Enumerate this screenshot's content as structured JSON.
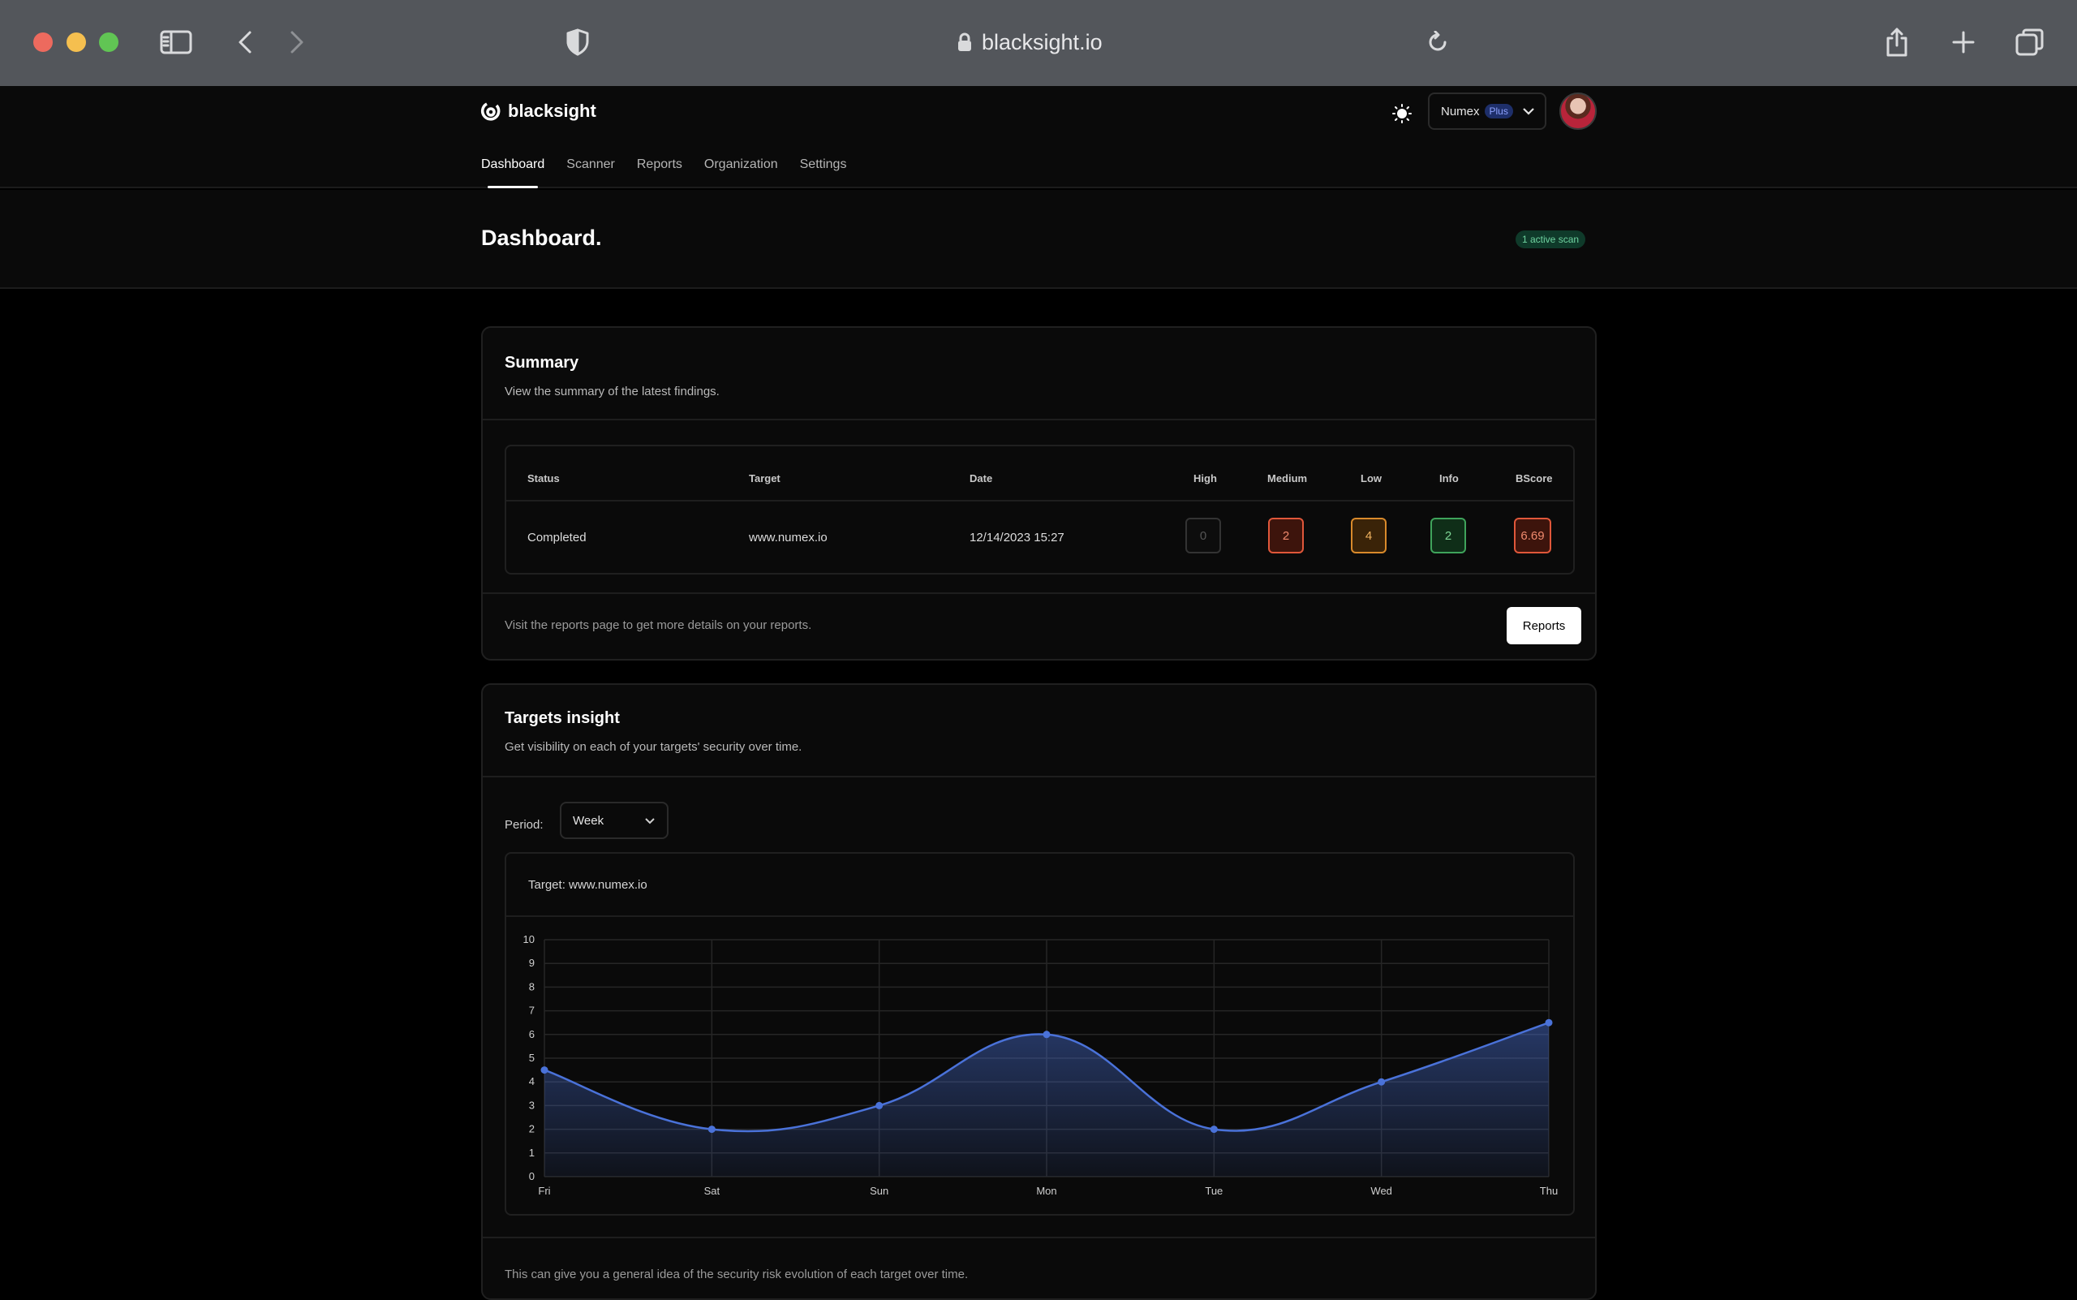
{
  "browser": {
    "url": "blacksight.io"
  },
  "app": {
    "brand": "blacksight",
    "nav": [
      {
        "label": "Dashboard",
        "active": true
      },
      {
        "label": "Scanner"
      },
      {
        "label": "Reports"
      },
      {
        "label": "Organization"
      },
      {
        "label": "Settings"
      }
    ],
    "org": {
      "name": "Numex",
      "plan": "Plus"
    }
  },
  "page": {
    "title": "Dashboard.",
    "badge": "1 active scan"
  },
  "summary": {
    "title": "Summary",
    "description": "View the summary of the latest findings.",
    "columns": [
      "Status",
      "Target",
      "Date",
      "High",
      "Medium",
      "Low",
      "Info",
      "BScore"
    ],
    "row": {
      "status": "Completed",
      "target": "www.numex.io",
      "date": "12/14/2023 15:27",
      "high": "0",
      "medium": "2",
      "low": "4",
      "info": "2",
      "bscore": "6.69"
    },
    "footer_text": "Visit the reports page to get more details on your reports.",
    "button": "Reports"
  },
  "insight": {
    "title": "Targets insight",
    "description": "Get visibility on each of your targets' security over time.",
    "period_label": "Period:",
    "period_value": "Week",
    "target_label": "Target: www.numex.io",
    "footer_note": "This can give you a general idea of the security risk evolution of each target over time."
  },
  "chart_data": {
    "type": "area",
    "categories": [
      "Fri",
      "Sat",
      "Sun",
      "Mon",
      "Tue",
      "Wed",
      "Thu"
    ],
    "values": [
      4.5,
      2,
      3,
      6,
      2,
      4,
      6.5
    ],
    "ylim": [
      0,
      10
    ],
    "yticks": [
      0,
      1,
      2,
      3,
      4,
      5,
      6,
      7,
      8,
      9,
      10
    ],
    "grid": true,
    "color": "#4a72d9"
  },
  "colors": {
    "medium": "#e0573a",
    "low": "#d98a2b",
    "info": "#3fa35b",
    "bscore": "#e0573a"
  }
}
